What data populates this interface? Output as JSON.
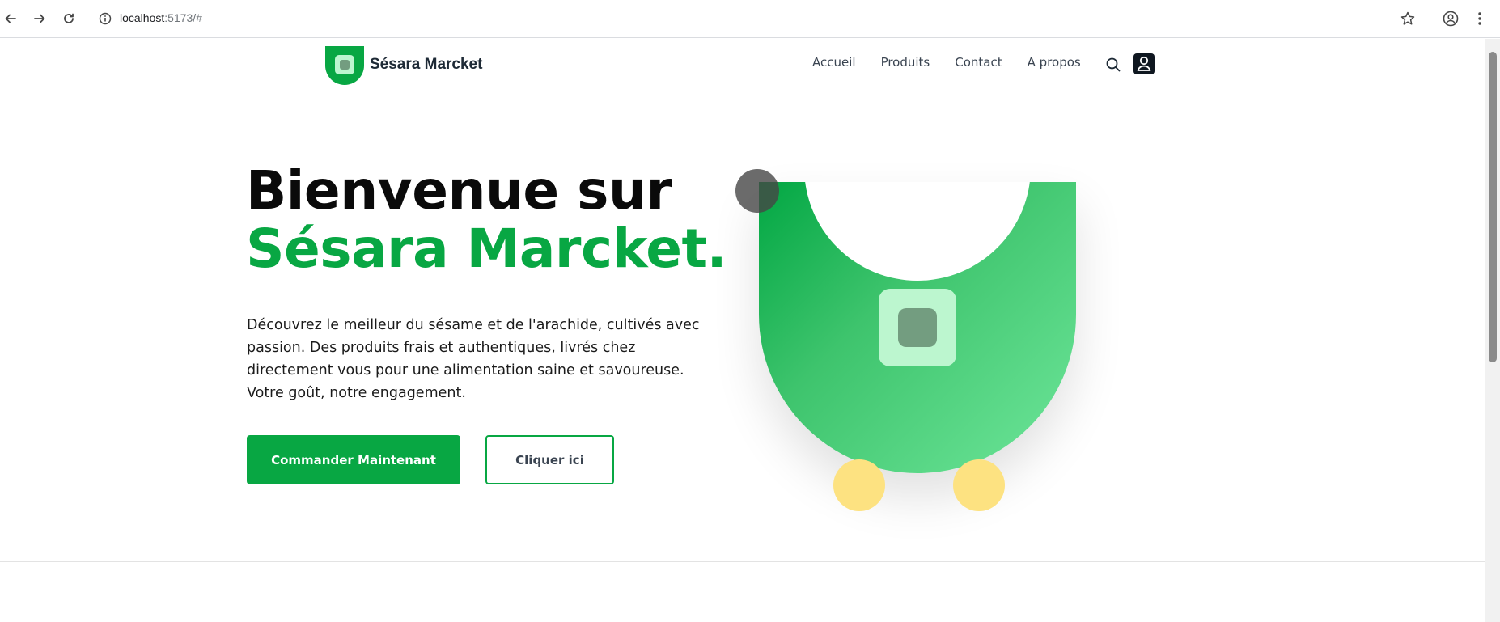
{
  "browser": {
    "url_host": "localhost",
    "url_rest": ":5173/#"
  },
  "header": {
    "brand": "Sésara Marcket",
    "nav": [
      "Accueil",
      "Produits",
      "Contact",
      "A propos"
    ]
  },
  "hero": {
    "title_line1": "Bienvenue sur",
    "title_line2": "Sésara Marcket.",
    "description": "Découvrez le meilleur du sésame et de l'arachide, cultivés avec passion. Des produits frais et authentiques, livrés chez directement vous pour une alimentation saine et savoureuse. Votre goût, notre engagement.",
    "primary_button": "Commander Maintenant",
    "secondary_button": "Cliquer ici"
  },
  "colors": {
    "brand_green": "#08a743",
    "light_green": "#bcf6cf",
    "muted_green": "#739d80",
    "yellow": "#fde281"
  },
  "icons": [
    "back-icon",
    "forward-icon",
    "reload-icon",
    "info-icon",
    "star-icon",
    "profile-icon",
    "menu-icon",
    "search-icon",
    "user-icon"
  ]
}
